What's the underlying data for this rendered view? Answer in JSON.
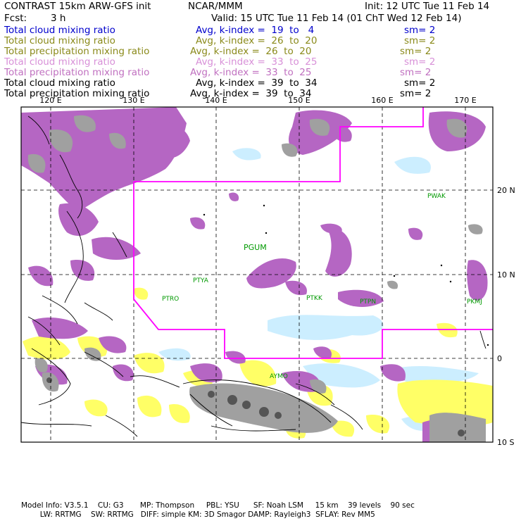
{
  "header": {
    "title": "CONTRAST 15km ARW-GFS init",
    "org": "NCAR/MMM",
    "init": "Init: 12 UTC Tue 11 Feb 14",
    "fcst_label": "Fcst:",
    "fcst_value": "3 h",
    "valid": "Valid: 15 UTC Tue 11 Feb 14 (01 ChT Wed 12 Feb 14)"
  },
  "legend": [
    {
      "field": "Total cloud mixing ratio",
      "avg": "Avg, k-index =  19  to   4",
      "sm": "sm= 2",
      "color": "#0000cc"
    },
    {
      "field": "Total cloud mixing ratio",
      "avg": "Avg, k-index =  26  to  20",
      "sm": "sm= 2",
      "color": "#8a8a1a"
    },
    {
      "field": "Total precipitation mixing ratio",
      "avg": "Avg, k-index =  26  to  20",
      "sm": "sm= 2",
      "color": "#8a8a1a"
    },
    {
      "field": "Total cloud mixing ratio",
      "avg": "Avg, k-index =  33  to  25",
      "sm": "sm= 2",
      "color": "#d890d8"
    },
    {
      "field": "Total precipitation mixing ratio",
      "avg": "Avg, k-index =  33  to  25",
      "sm": "sm= 2",
      "color": "#c070c0"
    },
    {
      "field": "Total cloud mixing ratio",
      "avg": "Avg, k-index =  39  to  34",
      "sm": "sm= 2",
      "color": "#000000"
    },
    {
      "field": "Total precipitation mixing ratio",
      "avg": "Avg, k-index =  39  to  34",
      "sm": "sm= 2",
      "color": "#000000"
    }
  ],
  "map": {
    "lon_labels": [
      "120 E",
      "130 E",
      "140 E",
      "150 E",
      "160 E",
      "170 E"
    ],
    "lat_labels": [
      "20 N",
      "10 N",
      "0",
      "10 S"
    ],
    "lon_range_deg_e": [
      114,
      176
    ],
    "lat_range_deg": [
      -10,
      27
    ],
    "stations": [
      {
        "id": "PWAK",
        "lon": 166.6,
        "lat": 19.3
      },
      {
        "id": "PGUM",
        "lon": 144.8,
        "lat": 13.5
      },
      {
        "id": "PTYA",
        "lon": 138.1,
        "lat": 9.5
      },
      {
        "id": "PTRO",
        "lon": 134.5,
        "lat": 7.4
      },
      {
        "id": "PTKK",
        "lon": 151.8,
        "lat": 7.5
      },
      {
        "id": "PTPN",
        "lon": 158.2,
        "lat": 7.0
      },
      {
        "id": "PKMJ",
        "lon": 171.3,
        "lat": 7.1
      },
      {
        "id": "AYMO",
        "lon": 147.4,
        "lat": -2.1
      }
    ],
    "colors": {
      "purple": "#b566c3",
      "yellow": "#ffff66",
      "light_blue": "#cceeff",
      "gray": "#a0a0a0",
      "dark_gray": "#555555",
      "boundary": "#ff00ff",
      "station": "#009900"
    }
  },
  "footer": {
    "line1": "Model Info: V3.5.1    CU: G3       MP: Thompson     PBL: YSU      SF: Noah LSM     15 km    39 levels    90 sec",
    "line2": "        LW: RRTMG    SW: RRTMG   DIFF: simple KM: 3D Smagor DAMP: Rayleigh3  SFLAY: Rev MM5"
  }
}
